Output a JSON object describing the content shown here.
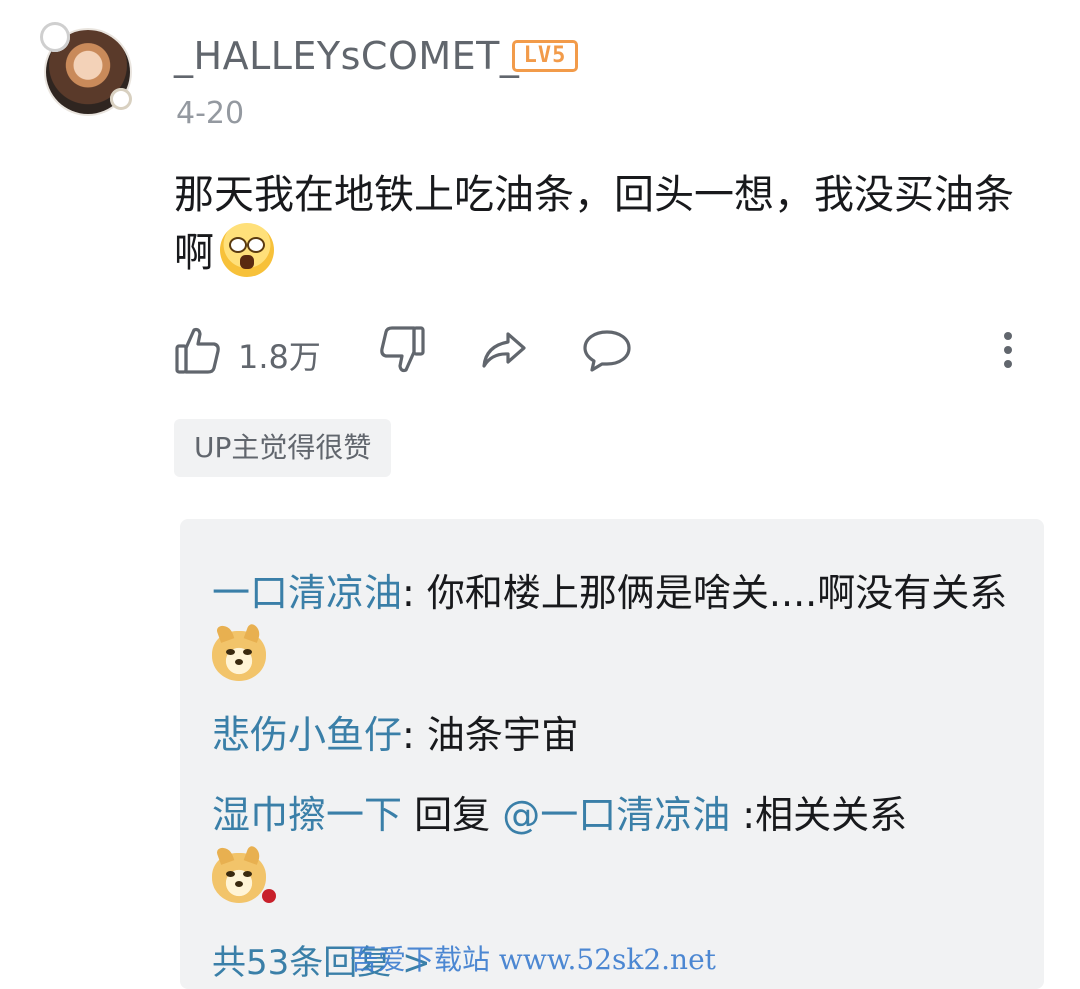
{
  "comment": {
    "username": "_HALLEYsCOMET_",
    "level_badge": "LV5",
    "date": "4-20",
    "text": "那天我在地铁上吃油条，回头一想，我没买油条啊",
    "text_emoji": "shocked-face-emoji",
    "like_count": "1.8万",
    "up_tag": "UP主觉得很赞"
  },
  "actions": {
    "icons": [
      "thumbs-up-icon",
      "thumbs-down-icon",
      "share-icon",
      "reply-bubble-icon",
      "more-vertical-icon"
    ]
  },
  "replies": {
    "items": [
      {
        "user": "一口清凉油",
        "sep": ": ",
        "text": "你和楼上那俩是啥关....啊没有关系",
        "emoji": "doge-emoji"
      },
      {
        "user": "悲伤小鱼仔",
        "sep": ": ",
        "text": "油条宇宙"
      },
      {
        "user": "湿巾擦一下",
        "reply_word": " 回复 ",
        "mention": "@一口清凉油",
        "sep": " :",
        "text": "相关关系",
        "emoji": "doge-rose-emoji"
      }
    ],
    "total": "共53条回复 >"
  },
  "watermark": "吾爱下载站 www.52sk2.net",
  "colors": {
    "link_blue": "#3a7fa8",
    "level_orange": "#f29b4a",
    "gray_text": "#61666d"
  }
}
